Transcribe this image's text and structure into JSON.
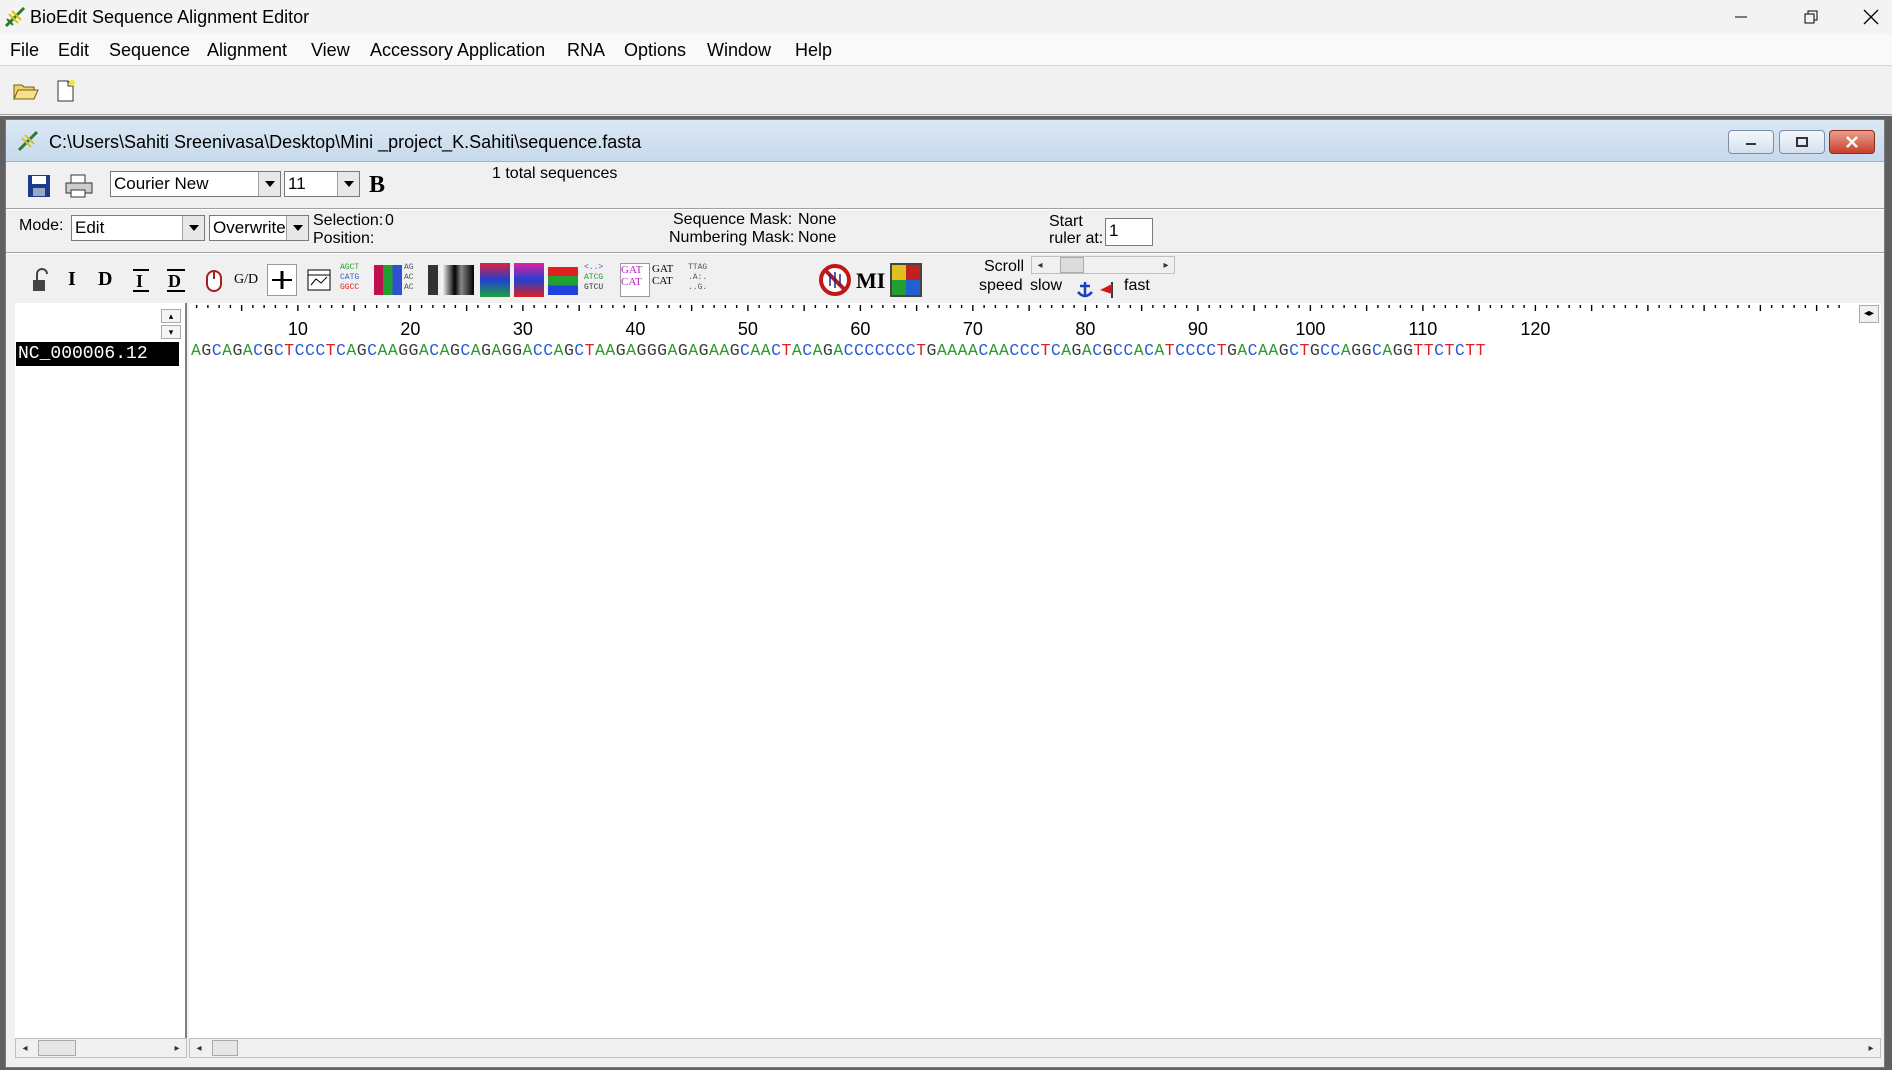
{
  "app": {
    "title": "BioEdit Sequence Alignment Editor",
    "menu": [
      "File",
      "Edit",
      "Sequence",
      "Alignment",
      "View",
      "Accessory Application",
      "RNA",
      "Options",
      "Window",
      "Help"
    ],
    "toolbar_icons": [
      "open-folder-icon",
      "new-document-icon"
    ]
  },
  "document": {
    "title": "C:\\Users\\Sahiti Sreenivasa\\Desktop\\Mini _project_K.Sahiti\\sequence.fasta",
    "font_name": "Courier New",
    "font_size": "11",
    "bold_label": "B",
    "total_sequences": "1 total sequences",
    "mode_label": "Mode:",
    "mode_value": "Edit",
    "edit_mode_value": "Overwrite",
    "selection_label": "Selection:",
    "selection_value": "0",
    "position_label": "Position:",
    "sequence_mask_label": "Sequence Mask:",
    "sequence_mask_value": "None",
    "numbering_mask_label": "Numbering Mask:",
    "numbering_mask_value": "None",
    "start_ruler_line1": "Start",
    "start_ruler_line2": "ruler at:",
    "start_ruler_value": "1",
    "scroll_label": "Scroll",
    "speed_label": "speed",
    "slow_label": "slow",
    "fast_label": "fast",
    "tool_labels": {
      "insert": "I",
      "delete": "D",
      "gd": "G/D",
      "mi": "MI"
    }
  },
  "ruler_numbers": [
    "10",
    "20",
    "30",
    "40",
    "50",
    "60",
    "70",
    "80",
    "90",
    "100",
    "110",
    "120"
  ],
  "sequences": [
    {
      "name": "NC_000006.12",
      "residues": "AGCAGACGCTCCCTCAGCAAGGACAGCAGAGGACCAGCTAAGAGGGAGAGAAGCAACTACAGACCCCCCCTGAAAACAACCCTCAGACGCCACATCCCCTGACAAGCTGCCAGGCAGGTTCTCTT"
    }
  ],
  "colors": {
    "A": "#2e9a2e",
    "C": "#2a5ad8",
    "G": "#3a3a3a",
    "T": "#e02020",
    "title_gradient_top": "#dbe8f5",
    "close_red": "#c8402a"
  }
}
